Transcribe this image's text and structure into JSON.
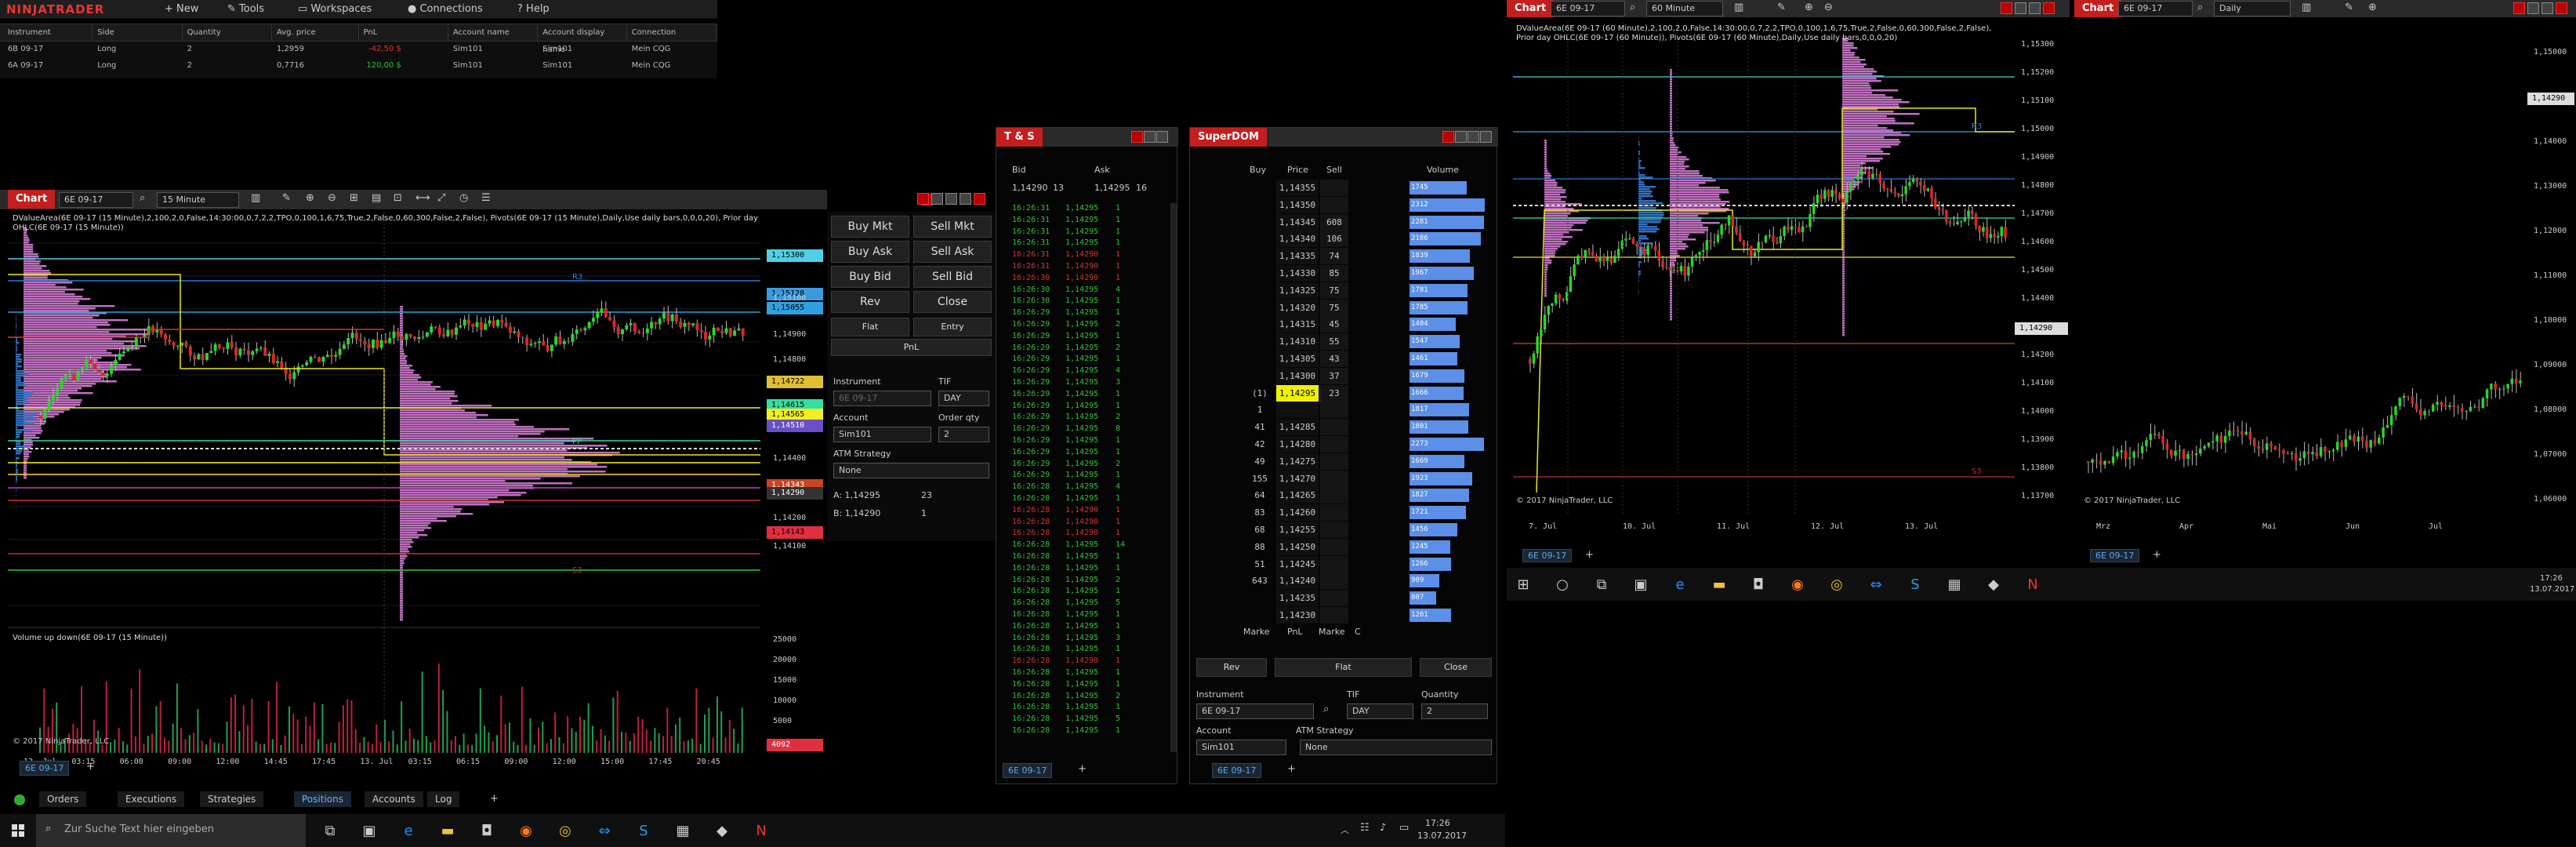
{
  "app": {
    "logo": "NINJATRADER",
    "menu": [
      "New",
      "Tools",
      "Workspaces",
      "Connections",
      "Help"
    ]
  },
  "positions": {
    "headers": [
      "Instrument",
      "Side",
      "Quantity",
      "Avg. price",
      "PnL",
      "Account name",
      "Account display name",
      "Connection"
    ],
    "rows": [
      [
        "6B 09-17",
        "Long",
        "2",
        "1,2959",
        "-42,50 $",
        "Sim101",
        "Sim101",
        "Mein CQG"
      ],
      [
        "6A 09-17",
        "Long",
        "2",
        "0,7716",
        "120,00 $",
        "Sim101",
        "Sim101",
        "Mein CQG"
      ]
    ]
  },
  "chart1": {
    "tab": "Chart",
    "instrument": "6E 09-17",
    "interval": "15 Minute",
    "indicators": "DValueArea(6E 09-17 (15 Minute),2,100,2,0,False,14:30:00,0,7,2,2,TPO,0,100,1,6,75,True,2,False,0,60,300,False,2,False), Pivots(6E 09-17 (15 Minute),Daily,Use daily bars,0,0,0,20), Prior day OHLC(6E 09-17 (15 Minute))",
    "price_ticks": [
      "1,15300",
      "1,15128",
      "1,15100",
      "1,15055",
      "1,14900",
      "1,14800",
      "1,14722",
      "1,14615",
      "1,14565",
      "1,14510",
      "1,14400",
      "1,14343",
      "1,14290",
      "1,14200",
      "1,14143",
      "1,14100"
    ],
    "time_ticks": [
      "12. Jul",
      "03:15",
      "06:00",
      "09:00",
      "12:00",
      "14:45",
      "17:45",
      "13. Jul",
      "03:15",
      "06:15",
      "09:00",
      "12:00",
      "15:00",
      "17:45",
      "20:45"
    ],
    "volume_label": "Volume up down(6E 09-17 (15 Minute))",
    "vol_ticks": [
      "25000",
      "20000",
      "15000",
      "10000",
      "5000",
      "4092"
    ],
    "copyright": "© 2017 NinjaTrader, LLC",
    "bottom_tab": "6E 09-17",
    "labels": {
      "r3": "R3",
      "s3": "S3",
      "pp": "PP"
    }
  },
  "order": {
    "buy_mkt": "Buy Mkt",
    "sell_mkt": "Sell Mkt",
    "buy_ask": "Buy Ask",
    "sell_ask": "Sell Ask",
    "buy_bid": "Buy Bid",
    "sell_bid": "Sell Bid",
    "rev": "Rev",
    "close": "Close",
    "flat": "Flat",
    "entry": "Entry",
    "pnl": "PnL",
    "instrument_label": "Instrument",
    "instrument": "6E 09-17",
    "tif_label": "TIF",
    "tif": "DAY",
    "account_label": "Account",
    "account": "Sim101",
    "qty_label": "Order qty",
    "qty": "2",
    "atm_label": "ATM Strategy",
    "atm": "None",
    "ask": "A: 1,14295",
    "ask_size": "23",
    "bid": "B: 1,14290",
    "bid_size": "1"
  },
  "ts": {
    "title": "T & S",
    "bid_label": "Bid",
    "ask_label": "Ask",
    "bid": "1,14290",
    "bid_size": "13",
    "ask": "1,14295",
    "ask_size": "16",
    "bottom_tab": "6E 09-17",
    "rows": [
      [
        "16:26:31",
        "1,14295",
        "1",
        "g"
      ],
      [
        "16:26:31",
        "1,14295",
        "1",
        "g"
      ],
      [
        "16:26:31",
        "1,14295",
        "1",
        "g"
      ],
      [
        "16:26:31",
        "1,14295",
        "1",
        "g"
      ],
      [
        "16:26:31",
        "1,14290",
        "1",
        "r"
      ],
      [
        "16:26:31",
        "1,14290",
        "1",
        "r"
      ],
      [
        "16:26:30",
        "1,14290",
        "1",
        "r"
      ],
      [
        "16:26:30",
        "1,14295",
        "4",
        "g"
      ],
      [
        "16:26:30",
        "1,14295",
        "1",
        "g"
      ],
      [
        "16:26:29",
        "1,14295",
        "1",
        "g"
      ],
      [
        "16:26:29",
        "1,14295",
        "2",
        "g"
      ],
      [
        "16:26:29",
        "1,14295",
        "1",
        "g"
      ],
      [
        "16:26:29",
        "1,14295",
        "2",
        "g"
      ],
      [
        "16:26:29",
        "1,14295",
        "1",
        "g"
      ],
      [
        "16:26:29",
        "1,14295",
        "4",
        "g"
      ],
      [
        "16:26:29",
        "1,14295",
        "3",
        "g"
      ],
      [
        "16:26:29",
        "1,14295",
        "1",
        "g"
      ],
      [
        "16:26:29",
        "1,14295",
        "1",
        "g"
      ],
      [
        "16:26:29",
        "1,14295",
        "2",
        "g"
      ],
      [
        "16:26:29",
        "1,14295",
        "8",
        "g"
      ],
      [
        "16:26:29",
        "1,14295",
        "1",
        "g"
      ],
      [
        "16:26:29",
        "1,14295",
        "1",
        "g"
      ],
      [
        "16:26:29",
        "1,14295",
        "2",
        "g"
      ],
      [
        "16:26:29",
        "1,14295",
        "1",
        "g"
      ],
      [
        "16:26:28",
        "1,14295",
        "4",
        "g"
      ],
      [
        "16:26:28",
        "1,14295",
        "1",
        "g"
      ],
      [
        "16:26:28",
        "1,14290",
        "1",
        "r"
      ],
      [
        "16:26:28",
        "1,14290",
        "1",
        "r"
      ],
      [
        "16:26:28",
        "1,14290",
        "1",
        "r"
      ],
      [
        "16:26:28",
        "1,14295",
        "14",
        "g"
      ],
      [
        "16:26:28",
        "1,14295",
        "1",
        "g"
      ],
      [
        "16:26:28",
        "1,14295",
        "1",
        "g"
      ],
      [
        "16:26:28",
        "1,14295",
        "2",
        "g"
      ],
      [
        "16:26:28",
        "1,14295",
        "1",
        "g"
      ],
      [
        "16:26:28",
        "1,14295",
        "5",
        "g"
      ],
      [
        "16:26:28",
        "1,14295",
        "1",
        "g"
      ],
      [
        "16:26:28",
        "1,14295",
        "1",
        "g"
      ],
      [
        "16:26:28",
        "1,14295",
        "3",
        "g"
      ],
      [
        "16:26:28",
        "1,14295",
        "1",
        "g"
      ],
      [
        "16:26:28",
        "1,14290",
        "1",
        "r"
      ],
      [
        "16:26:28",
        "1,14295",
        "1",
        "g"
      ],
      [
        "16:26:28",
        "1,14295",
        "1",
        "g"
      ],
      [
        "16:26:28",
        "1,14295",
        "2",
        "g"
      ],
      [
        "16:26:28",
        "1,14295",
        "1",
        "g"
      ],
      [
        "16:26:28",
        "1,14295",
        "5",
        "g"
      ],
      [
        "16:26:28",
        "1,14295",
        "1",
        "g"
      ]
    ]
  },
  "dom": {
    "title": "SuperDOM",
    "buy": "Buy",
    "price": "Price",
    "sell": "Sell",
    "volume": "Volume",
    "rows": [
      [
        "",
        "1,14355",
        "",
        ""
      ],
      [
        "",
        "1,14350",
        "",
        ""
      ],
      [
        "",
        "1,14345",
        "608",
        ""
      ],
      [
        "",
        "1,14340",
        "106",
        ""
      ],
      [
        "",
        "1,14335",
        "74",
        ""
      ],
      [
        "",
        "1,14330",
        "85",
        ""
      ],
      [
        "",
        "1,14325",
        "75",
        ""
      ],
      [
        "",
        "1,14320",
        "75",
        ""
      ],
      [
        "",
        "1,14315",
        "45",
        ""
      ],
      [
        "",
        "1,14310",
        "55",
        ""
      ],
      [
        "",
        "1,14305",
        "43",
        ""
      ],
      [
        "",
        "1,14300",
        "37",
        ""
      ],
      [
        "(1)",
        "1,14295",
        "23",
        "cur"
      ],
      [
        "1",
        "",
        "",
        ""
      ],
      [
        "41",
        "1,14285",
        "",
        ""
      ],
      [
        "42",
        "1,14280",
        "",
        ""
      ],
      [
        "49",
        "1,14275",
        "",
        ""
      ],
      [
        "155",
        "1,14270",
        "",
        ""
      ],
      [
        "64",
        "1,14265",
        "",
        ""
      ],
      [
        "83",
        "1,14260",
        "",
        ""
      ],
      [
        "68",
        "1,14255",
        "",
        ""
      ],
      [
        "88",
        "1,14250",
        "",
        ""
      ],
      [
        "51",
        "1,14245",
        "",
        ""
      ],
      [
        "643",
        "1,14240",
        "",
        ""
      ],
      [
        "",
        "1,14235",
        "",
        ""
      ],
      [
        "",
        "1,14230",
        "",
        ""
      ]
    ],
    "vols": [
      "1745",
      "2312",
      "2281",
      "2186",
      "1839",
      "1967",
      "1781",
      "1785",
      "1404",
      "1547",
      "1461",
      "1679",
      "1666",
      "1817",
      "1801",
      "2273",
      "1669",
      "1923",
      "1827",
      "1721",
      "1456",
      "1245",
      "1266",
      "909",
      "807",
      "1261"
    ],
    "marke": "Marke",
    "pnl": "PnL",
    "c": "C",
    "rev": "Rev",
    "flat": "Flat",
    "close": "Close",
    "instrument_label": "Instrument",
    "instrument": "6E 09-17",
    "tif_label": "TIF",
    "tif": "DAY",
    "qty_label": "Quantity",
    "qty": "2",
    "account_label": "Account",
    "account": "Sim101",
    "atm_label": "ATM Strategy",
    "atm": "None",
    "bottom_tab": "6E 09-17"
  },
  "chart2": {
    "tab": "Chart",
    "instrument": "6E 09-17",
    "interval": "60 Minute",
    "indicators": "DValueArea(6E 09-17 (60 Minute),2,100,2,0,False,14:30:00,0,7,2,2,TPO,0,100,1,6,75,True,2,False,0,60,300,False,2,False), Prior day OHLC(6E 09-17 (60 Minute)), Pivots(6E 09-17 (60 Minute),Daily,Use daily bars,0,0,0,20)",
    "price_ticks": [
      "1,15300",
      "1,15200",
      "1,15100",
      "1,15000",
      "1,14900",
      "1,14800",
      "1,14700",
      "1,14600",
      "1,14500",
      "1,14400",
      "1,14290",
      "1,14200",
      "1,14100",
      "1,14000",
      "1,13900",
      "1,13800",
      "1,13700"
    ],
    "time_ticks": [
      "7. Jul",
      "10. Jul",
      "11. Jul",
      "12. Jul",
      "13. Jul"
    ],
    "copyright": "© 2017 NinjaTrader, LLC",
    "bottom_tab": "6E 09-17",
    "r3": "R3",
    "s3": "S3"
  },
  "chart3": {
    "tab": "Chart",
    "instrument": "6E 09-17",
    "interval": "Daily",
    "price_ticks": [
      "1,15000",
      "1,14290",
      "1,14000",
      "1,13000",
      "1,12000",
      "1,11000",
      "1,10000",
      "1,09000",
      "1,08000",
      "1,07000",
      "1,06000"
    ],
    "time_ticks": [
      "Mrz",
      "Apr",
      "Mai",
      "Jun",
      "Jul"
    ],
    "copyright": "© 2017 NinjaTrader, LLC",
    "bottom_tab": "6E 09-17"
  },
  "bottomtabs": [
    "Orders",
    "Executions",
    "Strategies",
    "Positions",
    "Accounts",
    "Log"
  ],
  "taskbar": {
    "search": "Zur Suche Text hier eingeben",
    "time": "17:26",
    "date": "13.07.2017"
  },
  "colors": {
    "accent_red": "#c41e1e",
    "profile": "#c070c0",
    "pos_green": "#26c826",
    "neg_red": "#e03030",
    "dom_blue": "#5b8fe8"
  }
}
